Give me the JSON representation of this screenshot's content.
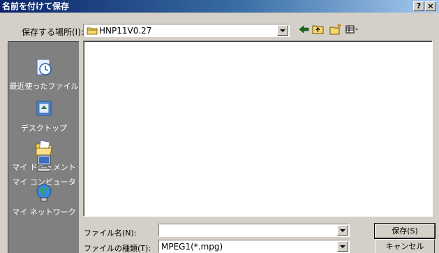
{
  "window": {
    "title": "名前を付けて保存",
    "help_glyph": "?",
    "close_glyph": "×"
  },
  "save_in": {
    "label": "保存する場所(I):",
    "value": "HNP11V0.27"
  },
  "toolbar": {
    "icons": [
      "back-arrow-icon",
      "up-folder-icon",
      "new-folder-icon",
      "view-menu-icon"
    ]
  },
  "places": [
    {
      "label": "最近使ったファイル",
      "icon": "recent-files-icon"
    },
    {
      "label": "デスクトップ",
      "icon": "desktop-icon"
    },
    {
      "label": "マイ ドキュメント",
      "icon": "my-documents-icon"
    },
    {
      "label": "マイ コンピュータ",
      "icon": "my-computer-icon"
    },
    {
      "label": "マイ ネットワーク",
      "icon": "my-network-icon"
    }
  ],
  "filename": {
    "label": "ファイル名(N):",
    "value": ""
  },
  "filetype": {
    "label": "ファイルの種類(T):",
    "value": "MPEG1(*.mpg)"
  },
  "buttons": {
    "save": "保存(S)",
    "cancel": "キャンセル"
  },
  "colors": {
    "face": "#d4d0c8",
    "title_start": "#0a246a",
    "title_end": "#a6caf0",
    "places_bar": "#808080"
  }
}
